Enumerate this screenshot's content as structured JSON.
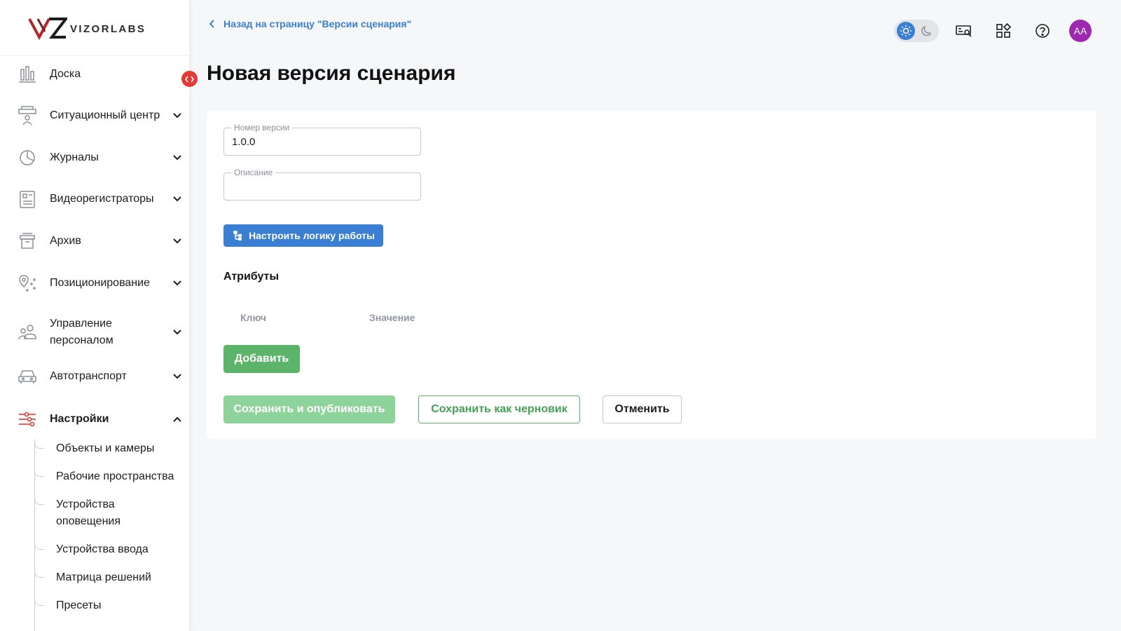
{
  "brand": {
    "name": "VIZORLABS"
  },
  "sidebar": {
    "items": [
      {
        "label": "Доска",
        "icon": "dashboard-icon"
      },
      {
        "label": "Ситуационный центр",
        "icon": "situation-center-icon"
      },
      {
        "label": "Журналы",
        "icon": "pie-chart-icon"
      },
      {
        "label": "Видеорегистраторы",
        "icon": "video-recorder-icon"
      },
      {
        "label": "Архив",
        "icon": "archive-icon"
      },
      {
        "label": "Позиционирование",
        "icon": "location-pin-icon"
      },
      {
        "label": "Управление\nперсоналом",
        "icon": "users-icon"
      },
      {
        "label": "Автотранспорт",
        "icon": "car-icon"
      },
      {
        "label": "Настройки",
        "icon": "sliders-icon"
      }
    ],
    "sub_items": [
      {
        "label": "Объекты и камеры"
      },
      {
        "label": "Рабочие пространства"
      },
      {
        "label": "Устройства\nоповещения"
      },
      {
        "label": "Устройства ввода"
      },
      {
        "label": "Матрица решений"
      },
      {
        "label": "Пресеты"
      }
    ]
  },
  "header": {
    "back_label": "Назад на страницу \"Версии сценария\"",
    "avatar_initials": "AA"
  },
  "page": {
    "title": "Новая версия сценария"
  },
  "form": {
    "version": {
      "label": "Номер версии",
      "value": "1.0.0"
    },
    "description": {
      "label": "Описание",
      "value": ""
    },
    "logic_button": "Настроить логику работы",
    "attributes_title": "Атрибуты",
    "columns": {
      "key": "Ключ",
      "value": "Значение"
    },
    "add_button": "Добавить",
    "publish_button": "Сохранить и опубликовать",
    "draft_button": "Сохранить как черновик",
    "cancel_button": "Отменить"
  },
  "colors": {
    "accent_blue": "#3b7fd4",
    "success_green": "#5cb46b",
    "danger_red": "#e53935",
    "avatar_purple": "#9c27b0",
    "settings_red": "#e53935"
  }
}
